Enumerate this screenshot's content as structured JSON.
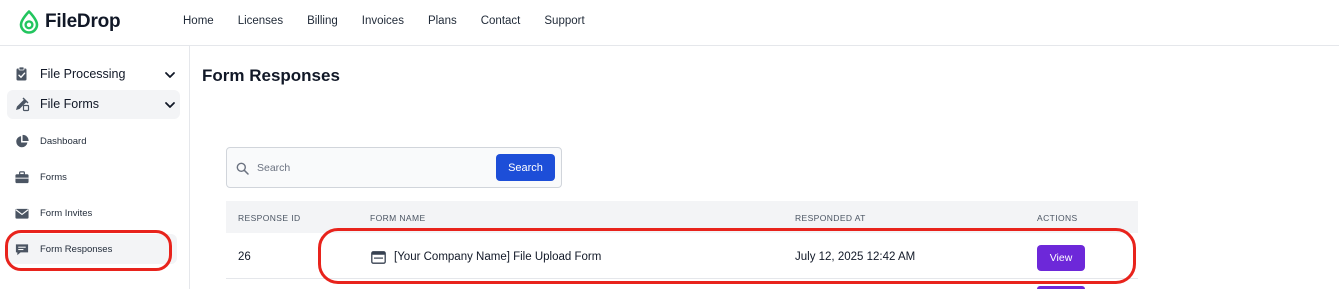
{
  "app": {
    "name": "FileDrop",
    "brand_color": "#22c55e"
  },
  "nav": [
    "Home",
    "Licenses",
    "Billing",
    "Invoices",
    "Plans",
    "Contact",
    "Support"
  ],
  "sidebar": {
    "groups": [
      {
        "label": "File Processing",
        "icon": "clipboard-check-icon",
        "expanded": false
      },
      {
        "label": "File Forms",
        "icon": "pencil-ruler-icon",
        "expanded": true
      }
    ],
    "items": [
      {
        "label": "Dashboard",
        "icon": "pie-chart-icon"
      },
      {
        "label": "Forms",
        "icon": "briefcase-icon"
      },
      {
        "label": "Form Invites",
        "icon": "envelope-icon"
      },
      {
        "label": "Form Responses",
        "icon": "chat-bubble-icon",
        "active": true
      }
    ]
  },
  "main": {
    "title": "Form Responses",
    "search": {
      "placeholder": "Search",
      "button_label": "Search",
      "button_color": "#1d4ed8"
    },
    "table": {
      "columns": [
        "RESPONSE ID",
        "FORM NAME",
        "RESPONDED AT",
        "ACTIONS"
      ],
      "rows": [
        {
          "response_id": "26",
          "form_name": "[Your Company Name] File Upload Form",
          "responded_at": "July 12, 2025 12:42 AM",
          "action_label": "View"
        }
      ]
    },
    "action_color": "#6d28d9"
  },
  "annotation_color": "#e8231c"
}
